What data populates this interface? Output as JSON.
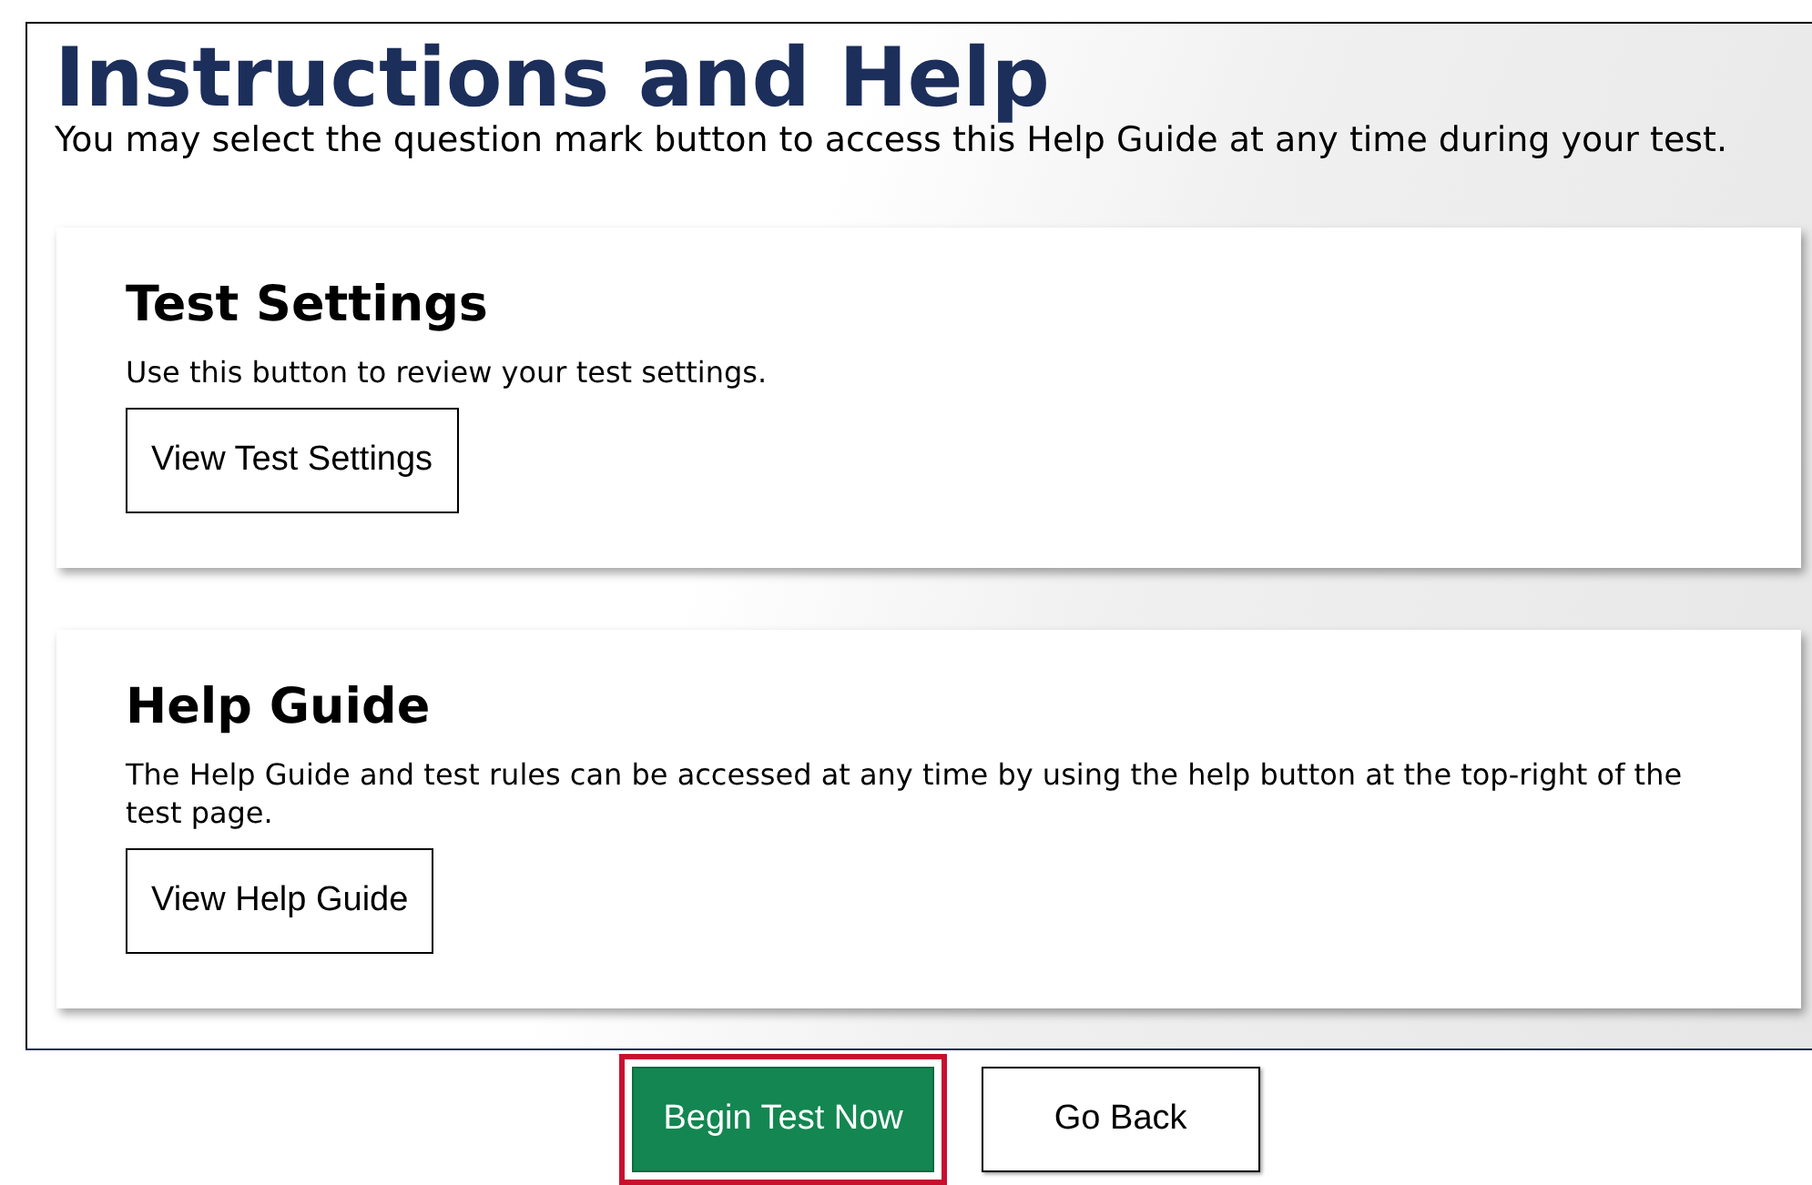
{
  "header": {
    "title": "Instructions and Help",
    "subtitle": "You may select the question mark button to access this Help Guide at any time during your test."
  },
  "cards": [
    {
      "title": "Test Settings",
      "text": "Use this button to review your test settings.",
      "button": "View Test Settings"
    },
    {
      "title": "Help Guide",
      "text": "The Help Guide and test rules can be accessed at any time by using the help button at the top-right of the test page.",
      "button": "View Help Guide"
    }
  ],
  "footer_buttons": [
    {
      "kind": "primary",
      "label": "Begin Test Now",
      "highlighted": true
    },
    {
      "kind": "secondary",
      "label": "Go Back",
      "highlighted": false
    }
  ]
}
